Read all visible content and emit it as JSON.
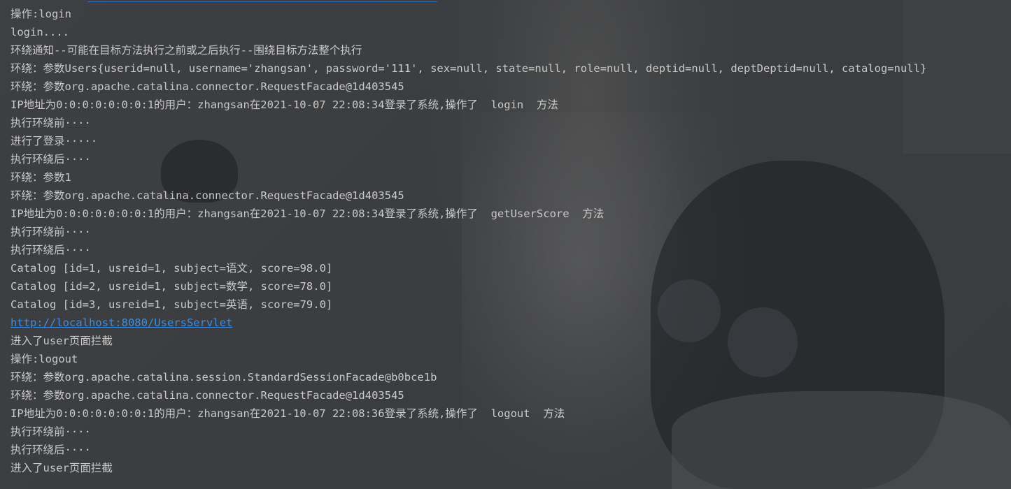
{
  "console": {
    "lines": [
      "操作:login",
      "login....",
      "环绕通知--可能在目标方法执行之前或之后执行--围绕目标方法整个执行",
      "环绕：参数Users{userid=null, username='zhangsan', password='111', sex=null, state=null, role=null, deptid=null, deptDeptid=null, catalog=null}",
      "环绕：参数org.apache.catalina.connector.RequestFacade@1d403545",
      "IP地址为0:0:0:0:0:0:0:1的用户：zhangsan在2021-10-07 22:08:34登录了系统,操作了  login  方法",
      "执行环绕前····",
      "进行了登录·····",
      "执行环绕后····",
      "环绕：参数1",
      "环绕：参数org.apache.catalina.connector.RequestFacade@1d403545",
      "IP地址为0:0:0:0:0:0:0:1的用户：zhangsan在2021-10-07 22:08:34登录了系统,操作了  getUserScore  方法",
      "执行环绕前····",
      "执行环绕后····",
      "Catalog [id=1, usreid=1, subject=语文, score=98.0]",
      "Catalog [id=2, usreid=1, subject=数学, score=78.0]",
      "Catalog [id=3, usreid=1, subject=英语, score=79.0]",
      "http://localhost:8080/UsersServlet",
      "进入了user页面拦截",
      "操作:logout",
      "环绕：参数org.apache.catalina.session.StandardSessionFacade@b0bce1b",
      "环绕：参数org.apache.catalina.connector.RequestFacade@1d403545",
      "IP地址为0:0:0:0:0:0:0:1的用户：zhangsan在2021-10-07 22:08:36登录了系统,操作了  logout  方法",
      "执行环绕前····",
      "执行环绕后····",
      "进入了user页面拦截"
    ]
  },
  "colors": {
    "text": "#c9c9c9",
    "link": "#3d8ee0",
    "background": "#3b3d40"
  }
}
